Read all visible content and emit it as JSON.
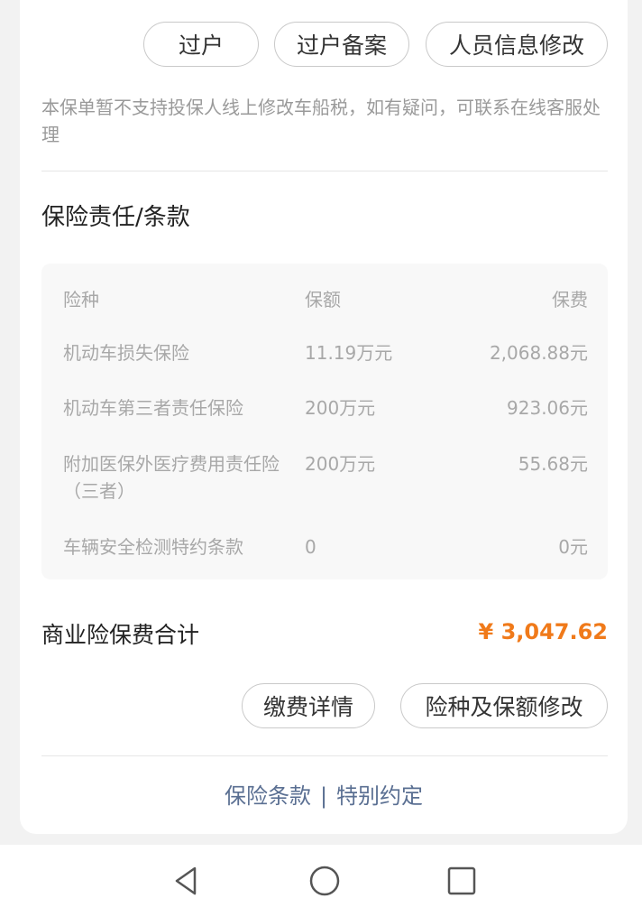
{
  "actions": {
    "transfer": "过户",
    "transfer_record": "过户备案",
    "edit_personal_info": "人员信息修改"
  },
  "notice": "本保单暂不支持投保人线上修改车船税，如有疑问，可联系在线客服处理",
  "section_title": "保险责任/条款",
  "coverage_table": {
    "headers": [
      "险种",
      "保额",
      "保费"
    ],
    "rows": [
      {
        "name": "机动车损失保险",
        "amount": "11.19万元",
        "premium": "2,068.88元"
      },
      {
        "name": "机动车第三者责任保险",
        "amount": "200万元",
        "premium": "923.06元"
      },
      {
        "name": "附加医保外医疗费用责任险（三者）",
        "amount": "200万元",
        "premium": "55.68元"
      },
      {
        "name": "车辆安全检测特约条款",
        "amount": "0",
        "premium": "0元"
      }
    ]
  },
  "total": {
    "label": "商业险保费合计",
    "value": "¥ 3,047.62"
  },
  "footer_actions": {
    "payment_details": "缴费详情",
    "edit_coverage": "险种及保额修改"
  },
  "links": {
    "clauses": "保险条款",
    "separator": "|",
    "special_agreement": "特别约定"
  },
  "colors": {
    "accent_orange": "#f07a1a",
    "link_blue": "#5a6f92"
  },
  "navbar": {
    "icons": [
      "back-icon",
      "home-icon",
      "recents-icon"
    ]
  }
}
